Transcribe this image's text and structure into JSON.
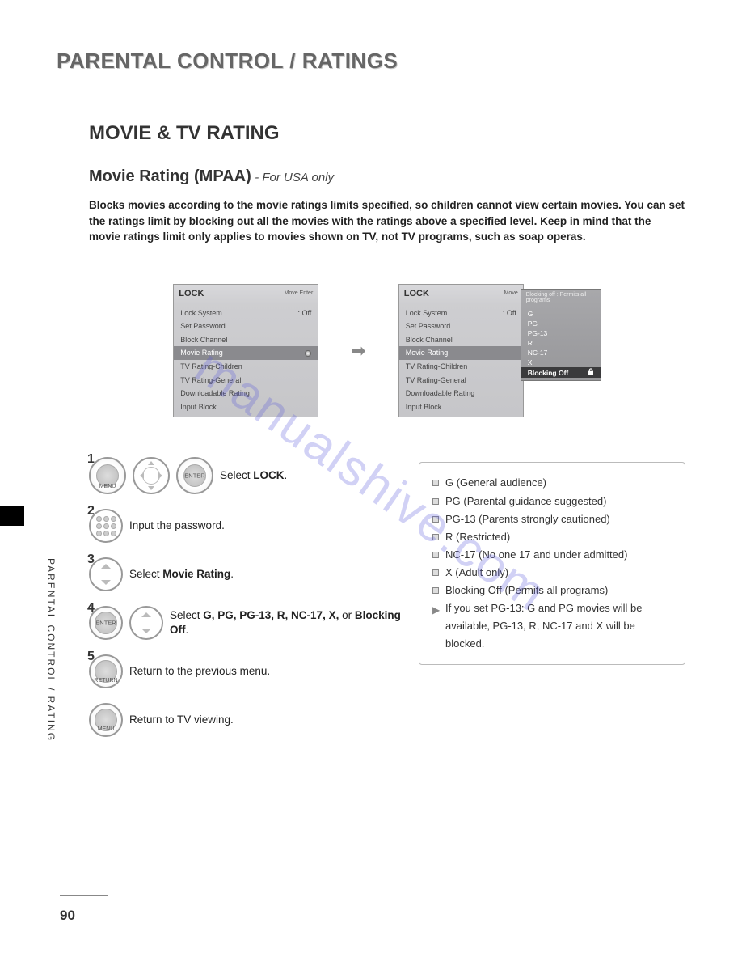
{
  "chapter": "PARENTAL CONTROL / RATINGS",
  "section": "MOVIE & TV RATING",
  "subsection": "Movie Rating (MPAA)",
  "subsection_note": "- For USA only",
  "intro": "Blocks movies according to the movie ratings limits specified, so children cannot view certain movies. You can set the ratings limit by blocking out all the movies with the ratings above a specified level. Keep in mind that the movie ratings limit only applies to movies shown on TV, not TV programs, such as soap operas.",
  "screen": {
    "title": "LOCK",
    "hint": "Move    Enter",
    "items": [
      {
        "label": "Lock System",
        "value": ": Off"
      },
      {
        "label": "Set Password",
        "value": ""
      },
      {
        "label": "Block Channel",
        "value": ""
      },
      {
        "label": "Movie Rating",
        "value": "",
        "selected": true
      },
      {
        "label": "TV Rating-Children",
        "value": ""
      },
      {
        "label": "TV Rating-General",
        "value": ""
      },
      {
        "label": "Downloadable Rating",
        "value": ""
      },
      {
        "label": "Input Block",
        "value": ""
      }
    ]
  },
  "popup": {
    "top": "Blocking off : Permits all programs",
    "items": [
      "G",
      "PG",
      "PG-13",
      "R",
      "NC-17",
      "X"
    ],
    "selected": "Blocking Off"
  },
  "steps": {
    "s1": {
      "label_menu": "MENU",
      "label_enter": "ENTER",
      "text_pre": "Select ",
      "text_bold": "LOCK",
      "text_post": "."
    },
    "s2": {
      "text": "Input the password."
    },
    "s3": {
      "text_pre": "Select ",
      "text_bold": "Movie Rating",
      "text_post": "."
    },
    "s4": {
      "label_enter": "ENTER",
      "text_pre": "Select ",
      "text_bold": "G, PG, PG-13, R, NC-17, X,",
      "text_mid": " or ",
      "text_bold2": "Blocking Off",
      "text_post": "."
    },
    "s5": {
      "label": "RETURN",
      "text": "Return to the previous menu."
    },
    "s6": {
      "label": "MENU",
      "text": "Return to TV viewing."
    }
  },
  "info": {
    "items": [
      "G (General audience)",
      "PG (Parental guidance suggested)",
      "PG-13 (Parents strongly cautioned)",
      "R (Restricted)",
      "NC-17 (No one 17 and under admitted)",
      "X (Adult only)",
      "Blocking Off (Permits all programs)"
    ],
    "note": "If you set PG-13: G and PG movies will be available, PG-13, R, NC-17 and X will be blocked."
  },
  "side_label": "PARENTAL CONTROL / RATING",
  "page_number": "90",
  "watermark": "manualshive.com"
}
